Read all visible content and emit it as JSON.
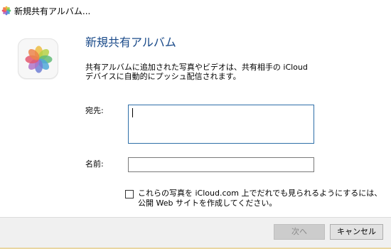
{
  "window": {
    "title": "新規共有アルバム..."
  },
  "dialog": {
    "heading": "新規共有アルバム",
    "description_lines": [
      "共有アルバムに追加された写真やビデオは、共有相手の iCloud",
      "デバイスに自動的にプッシュ配信されます。"
    ]
  },
  "form": {
    "to_label": "宛先:",
    "to_value": "",
    "name_label": "名前:",
    "name_value": ""
  },
  "public_website": {
    "checked": false,
    "label_lines": [
      "これらの写真を iCloud.com 上でだれでも見られるようにするには、",
      "公開 Web サイトを作成してください。"
    ]
  },
  "buttons": {
    "next_label": "次へ",
    "next_enabled": false,
    "cancel_label": "キャンセル"
  },
  "icons": {
    "title": "photos-icon",
    "app": "photos-app-icon"
  },
  "colors": {
    "heading": "#1b4b8a",
    "focus_border": "#2e6fa8",
    "footer_bg": "#f0f0f0"
  }
}
